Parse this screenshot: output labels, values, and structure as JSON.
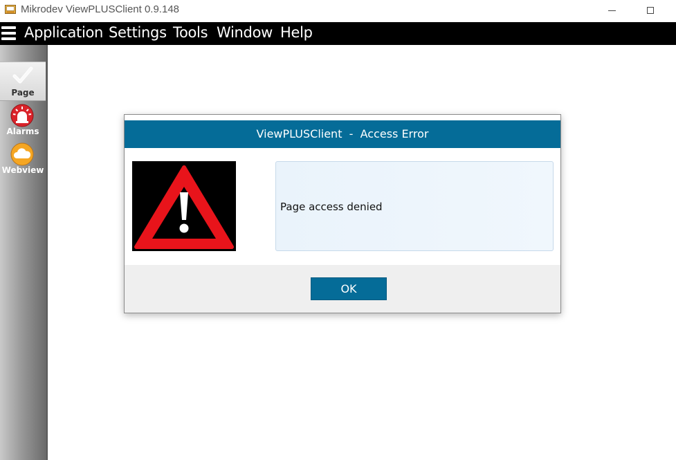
{
  "window": {
    "title": "Mikrodev ViewPLUSClient 0.9.148",
    "app_icon": "app-window-icon",
    "controls": [
      "minimize-icon",
      "maximize-icon"
    ]
  },
  "menubar": {
    "menu_icon": "hamburger-menu-icon",
    "items": [
      "Application",
      "Settings",
      "Tools",
      "Window",
      "Help"
    ]
  },
  "sidebar": {
    "items": [
      {
        "label": "Page",
        "icon": "checkmark-icon",
        "selected": true
      },
      {
        "label": "Alarms",
        "icon": "alarm-siren-icon",
        "selected": false
      },
      {
        "label": "Webview",
        "icon": "cloud-icon",
        "selected": false
      }
    ]
  },
  "dialog": {
    "title": "ViewPLUSClient  -  Access Error",
    "icon": "warning-triangle-icon",
    "message": "Page access denied",
    "ok_label": "OK"
  },
  "colors": {
    "header_blue": "#056c98",
    "menubar": "#000000",
    "warning_red": "#e8141b",
    "alarm_red": "#d9232a",
    "webview_orange": "#f5a623"
  }
}
